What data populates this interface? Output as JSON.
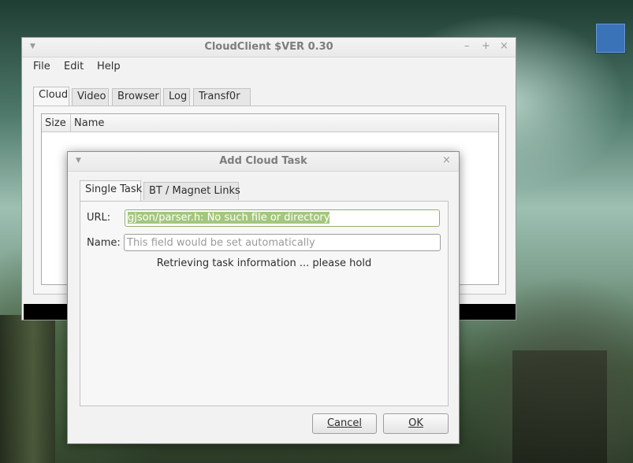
{
  "main_window": {
    "title": "CloudClient $VER 0.30",
    "menu": [
      {
        "label": "File"
      },
      {
        "label": "Edit"
      },
      {
        "label": "Help"
      }
    ],
    "tabs": [
      {
        "label": "Cloud",
        "active": true
      },
      {
        "label": "Video"
      },
      {
        "label": "Browser"
      },
      {
        "label": "Log"
      },
      {
        "label": "Transf0r"
      }
    ],
    "list_columns": [
      "Size",
      "Name"
    ]
  },
  "dialog": {
    "title": "Add Cloud Task",
    "tabs": [
      {
        "label": "Single Task",
        "active": true
      },
      {
        "label": "BT / Magnet Links"
      }
    ],
    "url_label": "URL:",
    "url_value": "gjson/parser.h: No such file or directory",
    "name_label": "Name:",
    "name_placeholder": "This field would be set automatically",
    "status": "Retrieving task information ... please hold",
    "cancel_label": "Cancel",
    "ok_label": "OK"
  },
  "colors": {
    "accent_selection": "#a3c77d",
    "desktop_icon": "#3b73b9"
  },
  "icons": [
    "window-menu-icon",
    "minimize-icon",
    "maximize-icon",
    "close-icon"
  ]
}
